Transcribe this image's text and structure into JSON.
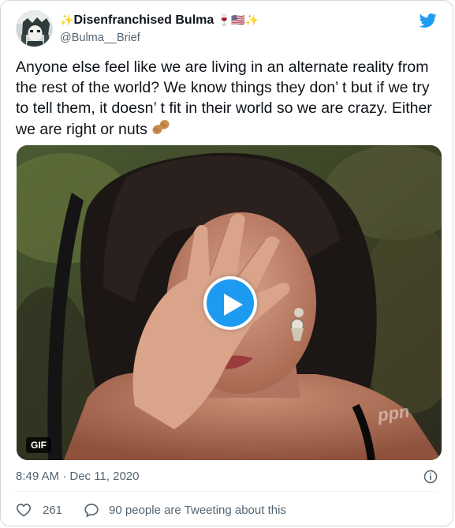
{
  "tweet": {
    "display_name": "Disenfranchised Bulma",
    "name_emoji_prefix": "✨",
    "name_emoji_suffix": "🍷🇺🇸✨",
    "handle": "@Bulma__Brief",
    "text": "Anyone else feel like we are living in an alternate reality from the rest of the world? We know things they don’ t but if we try to tell them, it doesn’ t fit in their world so we are crazy. Either we are right or nuts",
    "text_emoji": "peanut",
    "media": {
      "badge": "GIF",
      "watermark": "ppn"
    },
    "timestamp": "8:49 AM · Dec 11, 2020",
    "likes_count": "261",
    "conversation_label": "90 people are Tweeting about this"
  },
  "icons": {
    "brand": "twitter-bird-icon",
    "info": "info-icon",
    "like": "heart-icon",
    "reply": "speech-bubble-icon",
    "play": "play-icon"
  },
  "colors": {
    "accent": "#1d9bf0",
    "text_primary": "#0f1419",
    "text_secondary": "#536471",
    "border": "#cfd9de"
  }
}
